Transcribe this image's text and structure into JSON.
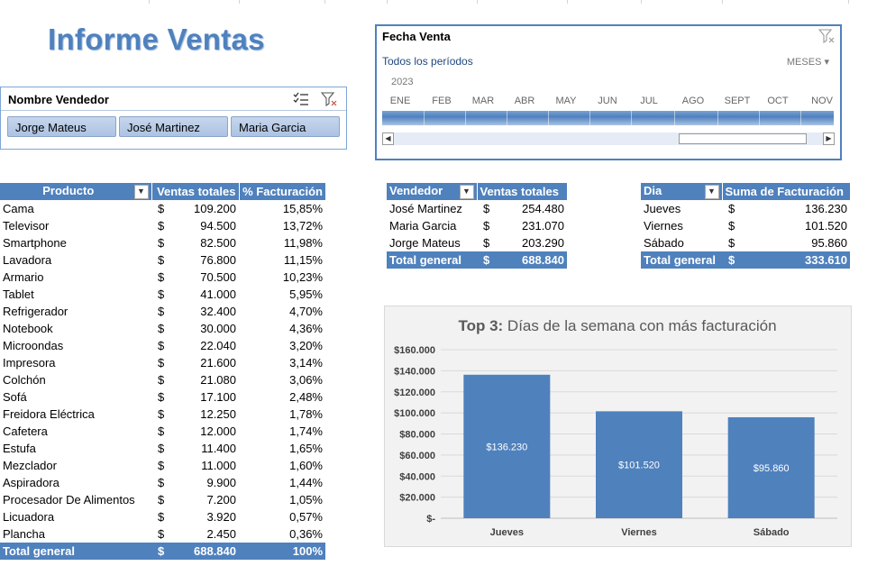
{
  "report_title": "Informe Ventas",
  "seller_slicer": {
    "title": "Nombre Vendedor",
    "multiselect_icon": "multiselect-icon",
    "clear_filter_icon": "clear-filter-icon",
    "items": [
      "Jorge Mateus",
      "José Martinez",
      "Maria Garcia"
    ]
  },
  "timeline": {
    "title": "Fecha Venta",
    "clear_filter_icon": "clear-filter-icon",
    "all_periods": "Todos los períodos",
    "level": "MESES",
    "year": "2023",
    "months": [
      "ENE",
      "FEB",
      "MAR",
      "ABR",
      "MAY",
      "JUN",
      "JUL",
      "AGO",
      "SEPT",
      "OCT",
      "NOV"
    ]
  },
  "product_table": {
    "headers": [
      "Producto",
      "Ventas totales",
      "% Facturación"
    ],
    "currency": "$",
    "rows": [
      [
        "Cama",
        "109.200",
        "15,85%"
      ],
      [
        "Televisor",
        "94.500",
        "13,72%"
      ],
      [
        "Smartphone",
        "82.500",
        "11,98%"
      ],
      [
        "Lavadora",
        "76.800",
        "11,15%"
      ],
      [
        "Armario",
        "70.500",
        "10,23%"
      ],
      [
        "Tablet",
        "41.000",
        "5,95%"
      ],
      [
        "Refrigerador",
        "32.400",
        "4,70%"
      ],
      [
        "Notebook",
        "30.000",
        "4,36%"
      ],
      [
        "Microondas",
        "22.040",
        "3,20%"
      ],
      [
        "Impresora",
        "21.600",
        "3,14%"
      ],
      [
        "Colchón",
        "21.080",
        "3,06%"
      ],
      [
        "Sofá",
        "17.100",
        "2,48%"
      ],
      [
        "Freidora Eléctrica",
        "12.250",
        "1,78%"
      ],
      [
        "Cafetera",
        "12.000",
        "1,74%"
      ],
      [
        "Estufa",
        "11.400",
        "1,65%"
      ],
      [
        "Mezclador",
        "11.000",
        "1,60%"
      ],
      [
        "Aspiradora",
        "9.900",
        "1,44%"
      ],
      [
        "Procesador De Alimentos",
        "7.200",
        "1,05%"
      ],
      [
        "Licuadora",
        "3.920",
        "0,57%"
      ],
      [
        "Plancha",
        "2.450",
        "0,36%"
      ]
    ],
    "total": [
      "Total general",
      "688.840",
      "100%"
    ]
  },
  "seller_table": {
    "headers": [
      "Vendedor",
      "Ventas totales"
    ],
    "currency": "$",
    "rows": [
      [
        "José Martinez",
        "254.480"
      ],
      [
        "Maria Garcia",
        "231.070"
      ],
      [
        "Jorge Mateus",
        "203.290"
      ]
    ],
    "total": [
      "Total general",
      "688.840"
    ]
  },
  "day_table": {
    "headers": [
      "Dia",
      "Suma de Facturación"
    ],
    "currency": "$",
    "rows": [
      [
        "Jueves",
        "136.230"
      ],
      [
        "Viernes",
        "101.520"
      ],
      [
        "Sábado",
        "95.860"
      ]
    ],
    "total": [
      "Total general",
      "333.610"
    ]
  },
  "colors": {
    "accent": "#4f81bd",
    "bar": "#4f81bd",
    "chart_bg": "#f2f2f2"
  },
  "chart_data": {
    "type": "bar",
    "title_bold": "Top 3:",
    "title_rest": " Días de la semana con más facturación",
    "categories": [
      "Jueves",
      "Viernes",
      "Sábado"
    ],
    "values": [
      136230,
      101520,
      95860
    ],
    "data_labels": [
      "$136.230",
      "$101.520",
      "$95.860"
    ],
    "ylim": [
      0,
      160000
    ],
    "yticks": [
      0,
      20000,
      40000,
      60000,
      80000,
      100000,
      120000,
      140000,
      160000
    ],
    "ytick_labels": [
      "$-",
      "$20.000",
      "$40.000",
      "$60.000",
      "$80.000",
      "$100.000",
      "$120.000",
      "$140.000",
      "$160.000"
    ],
    "grid": true,
    "legend": "none"
  }
}
